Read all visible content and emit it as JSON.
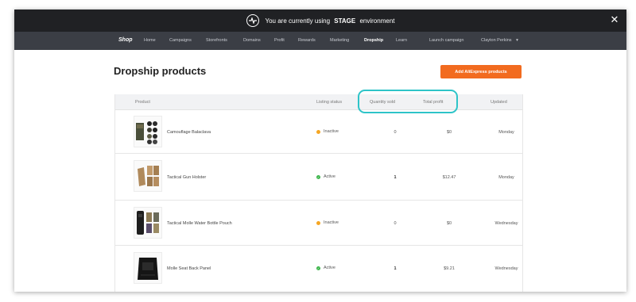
{
  "stage_bar": {
    "prefix": "You are currently using",
    "env": "STAGE",
    "suffix": "environment"
  },
  "nav": {
    "logo": "Shop",
    "items": [
      "Home",
      "Campaigns",
      "Storefronts",
      "Domains",
      "Profit",
      "Rewards",
      "Marketing",
      "Dropship",
      "Learn"
    ],
    "active": "Dropship",
    "launch": "Launch campaign",
    "user": "Clayton Perkins"
  },
  "page": {
    "title": "Dropship products",
    "add_button": "Add AliExpress products"
  },
  "table": {
    "headers": {
      "product": "Product",
      "status": "Listing status",
      "quantity": "Quantity sold",
      "profit": "Total profit",
      "updated": "Updated"
    },
    "rows": [
      {
        "name": "Camouflage Balaclava",
        "status": "Inactive",
        "quantity": "0",
        "profit": "$0",
        "updated": "Monday"
      },
      {
        "name": "Tactical Gun Holster",
        "status": "Active",
        "quantity": "1",
        "profit": "$12.47",
        "updated": "Monday"
      },
      {
        "name": "Tactical Molle Water Bottle Pouch",
        "status": "Inactive",
        "quantity": "0",
        "profit": "$0",
        "updated": "Wednesday"
      },
      {
        "name": "Molle Seat Back Panel",
        "status": "Active",
        "quantity": "1",
        "profit": "$9.21",
        "updated": "Wednesday"
      }
    ]
  },
  "colors": {
    "stage_bar": "#202124",
    "nav": "#3b3e45",
    "accent": "#f26b1f",
    "highlight": "#2ec4c8",
    "active_status": "#3bb54a",
    "inactive_status": "#f5a623"
  }
}
